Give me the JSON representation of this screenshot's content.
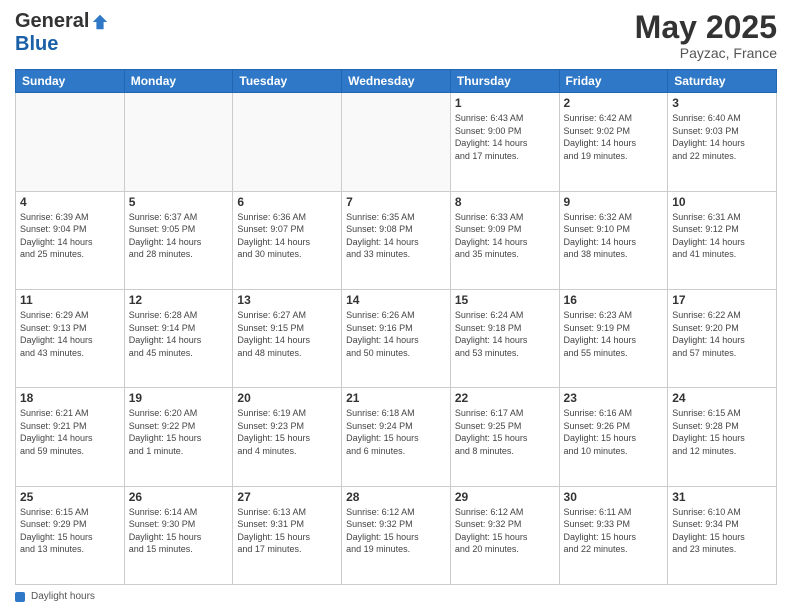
{
  "header": {
    "logo_general": "General",
    "logo_blue": "Blue",
    "month": "May 2025",
    "location": "Payzac, France"
  },
  "footer": {
    "daylight_label": "Daylight hours"
  },
  "weekdays": [
    "Sunday",
    "Monday",
    "Tuesday",
    "Wednesday",
    "Thursday",
    "Friday",
    "Saturday"
  ],
  "weeks": [
    [
      {
        "day": "",
        "info": ""
      },
      {
        "day": "",
        "info": ""
      },
      {
        "day": "",
        "info": ""
      },
      {
        "day": "",
        "info": ""
      },
      {
        "day": "1",
        "info": "Sunrise: 6:43 AM\nSunset: 9:00 PM\nDaylight: 14 hours\nand 17 minutes."
      },
      {
        "day": "2",
        "info": "Sunrise: 6:42 AM\nSunset: 9:02 PM\nDaylight: 14 hours\nand 19 minutes."
      },
      {
        "day": "3",
        "info": "Sunrise: 6:40 AM\nSunset: 9:03 PM\nDaylight: 14 hours\nand 22 minutes."
      }
    ],
    [
      {
        "day": "4",
        "info": "Sunrise: 6:39 AM\nSunset: 9:04 PM\nDaylight: 14 hours\nand 25 minutes."
      },
      {
        "day": "5",
        "info": "Sunrise: 6:37 AM\nSunset: 9:05 PM\nDaylight: 14 hours\nand 28 minutes."
      },
      {
        "day": "6",
        "info": "Sunrise: 6:36 AM\nSunset: 9:07 PM\nDaylight: 14 hours\nand 30 minutes."
      },
      {
        "day": "7",
        "info": "Sunrise: 6:35 AM\nSunset: 9:08 PM\nDaylight: 14 hours\nand 33 minutes."
      },
      {
        "day": "8",
        "info": "Sunrise: 6:33 AM\nSunset: 9:09 PM\nDaylight: 14 hours\nand 35 minutes."
      },
      {
        "day": "9",
        "info": "Sunrise: 6:32 AM\nSunset: 9:10 PM\nDaylight: 14 hours\nand 38 minutes."
      },
      {
        "day": "10",
        "info": "Sunrise: 6:31 AM\nSunset: 9:12 PM\nDaylight: 14 hours\nand 41 minutes."
      }
    ],
    [
      {
        "day": "11",
        "info": "Sunrise: 6:29 AM\nSunset: 9:13 PM\nDaylight: 14 hours\nand 43 minutes."
      },
      {
        "day": "12",
        "info": "Sunrise: 6:28 AM\nSunset: 9:14 PM\nDaylight: 14 hours\nand 45 minutes."
      },
      {
        "day": "13",
        "info": "Sunrise: 6:27 AM\nSunset: 9:15 PM\nDaylight: 14 hours\nand 48 minutes."
      },
      {
        "day": "14",
        "info": "Sunrise: 6:26 AM\nSunset: 9:16 PM\nDaylight: 14 hours\nand 50 minutes."
      },
      {
        "day": "15",
        "info": "Sunrise: 6:24 AM\nSunset: 9:18 PM\nDaylight: 14 hours\nand 53 minutes."
      },
      {
        "day": "16",
        "info": "Sunrise: 6:23 AM\nSunset: 9:19 PM\nDaylight: 14 hours\nand 55 minutes."
      },
      {
        "day": "17",
        "info": "Sunrise: 6:22 AM\nSunset: 9:20 PM\nDaylight: 14 hours\nand 57 minutes."
      }
    ],
    [
      {
        "day": "18",
        "info": "Sunrise: 6:21 AM\nSunset: 9:21 PM\nDaylight: 14 hours\nand 59 minutes."
      },
      {
        "day": "19",
        "info": "Sunrise: 6:20 AM\nSunset: 9:22 PM\nDaylight: 15 hours\nand 1 minute."
      },
      {
        "day": "20",
        "info": "Sunrise: 6:19 AM\nSunset: 9:23 PM\nDaylight: 15 hours\nand 4 minutes."
      },
      {
        "day": "21",
        "info": "Sunrise: 6:18 AM\nSunset: 9:24 PM\nDaylight: 15 hours\nand 6 minutes."
      },
      {
        "day": "22",
        "info": "Sunrise: 6:17 AM\nSunset: 9:25 PM\nDaylight: 15 hours\nand 8 minutes."
      },
      {
        "day": "23",
        "info": "Sunrise: 6:16 AM\nSunset: 9:26 PM\nDaylight: 15 hours\nand 10 minutes."
      },
      {
        "day": "24",
        "info": "Sunrise: 6:15 AM\nSunset: 9:28 PM\nDaylight: 15 hours\nand 12 minutes."
      }
    ],
    [
      {
        "day": "25",
        "info": "Sunrise: 6:15 AM\nSunset: 9:29 PM\nDaylight: 15 hours\nand 13 minutes."
      },
      {
        "day": "26",
        "info": "Sunrise: 6:14 AM\nSunset: 9:30 PM\nDaylight: 15 hours\nand 15 minutes."
      },
      {
        "day": "27",
        "info": "Sunrise: 6:13 AM\nSunset: 9:31 PM\nDaylight: 15 hours\nand 17 minutes."
      },
      {
        "day": "28",
        "info": "Sunrise: 6:12 AM\nSunset: 9:32 PM\nDaylight: 15 hours\nand 19 minutes."
      },
      {
        "day": "29",
        "info": "Sunrise: 6:12 AM\nSunset: 9:32 PM\nDaylight: 15 hours\nand 20 minutes."
      },
      {
        "day": "30",
        "info": "Sunrise: 6:11 AM\nSunset: 9:33 PM\nDaylight: 15 hours\nand 22 minutes."
      },
      {
        "day": "31",
        "info": "Sunrise: 6:10 AM\nSunset: 9:34 PM\nDaylight: 15 hours\nand 23 minutes."
      }
    ]
  ]
}
